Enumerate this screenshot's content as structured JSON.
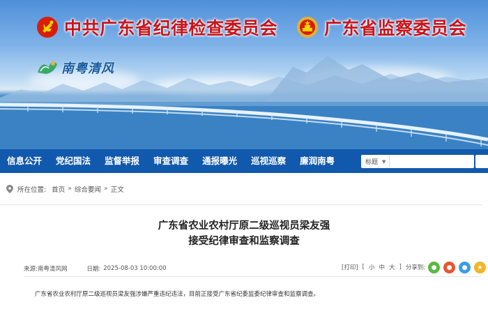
{
  "header": {
    "title_left": "中共广东省纪律检查委员会",
    "title_right": "广东省监察委员会",
    "logo_text": "南粤清风"
  },
  "nav": {
    "items": [
      "信息公开",
      "党纪国法",
      "监督举报",
      "审查调查",
      "通报曝光",
      "巡视巡察",
      "廉润南粤"
    ],
    "search_select": "标题",
    "search_placeholder": ""
  },
  "breadcrumb": {
    "prefix": "所在位置:",
    "items": [
      "首页",
      "综合要闻",
      "正文"
    ]
  },
  "article": {
    "title_line1": "广东省农业农村厅原二级巡视员梁友强",
    "title_line2": "接受纪律审查和监察调查",
    "source_label": "来源:",
    "source": "南粤清风网",
    "date_label": "日期:",
    "date": "2025-08-03 10:00:00",
    "print_label": "[打印]",
    "font_small": "小",
    "font_medium": "中",
    "font_large": "大",
    "share_label": "分享到:",
    "body": "广东省农业农村厅原二级巡视员梁友强涉嫌严重违纪违法，目前正接受广东省纪委监委纪律审查和监察调查。"
  },
  "colors": {
    "nav_bg": "#1159ac",
    "title_red": "#c8161d"
  }
}
